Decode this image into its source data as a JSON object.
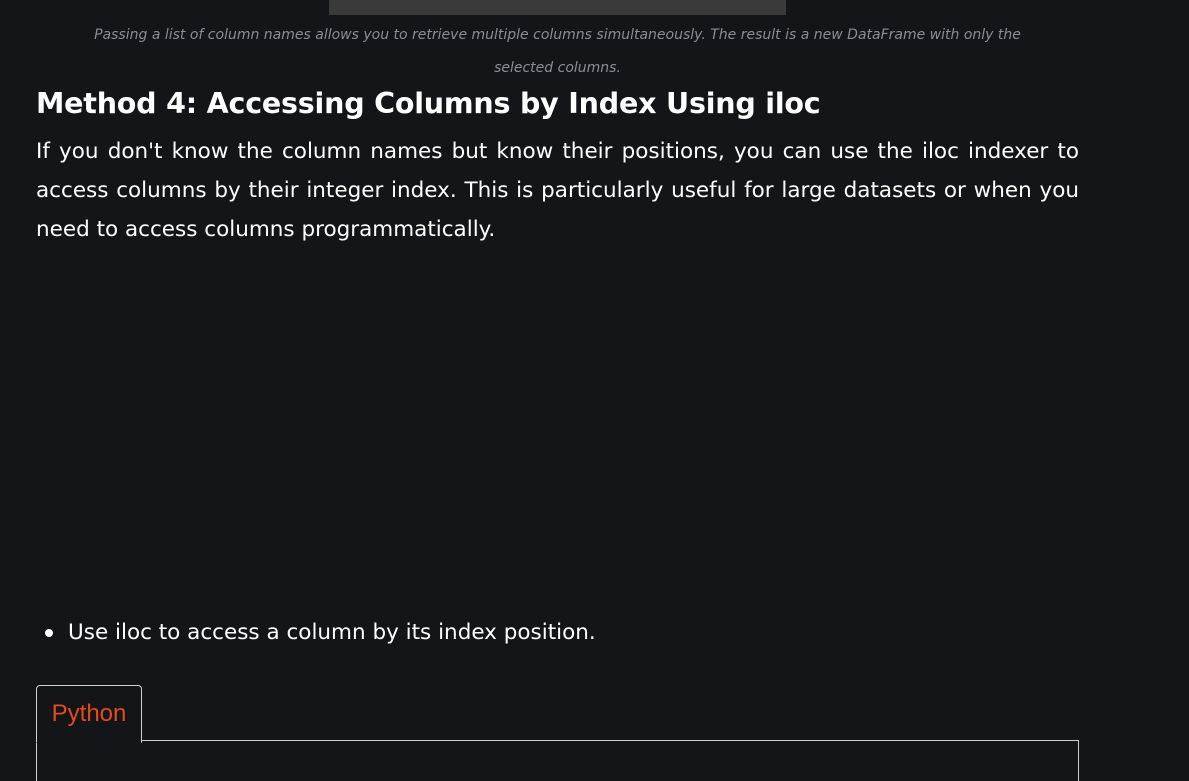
{
  "caption": {
    "line1": "Passing a list of column names allows you to retrieve multiple columns simultaneously. The result is a new DataFrame with only the",
    "line2": "selected columns."
  },
  "section": {
    "heading": "Method 4: Accessing Columns by Index Using iloc",
    "paragraph": "If you don't know the column names but know their positions, you can use the iloc indexer to access columns by their integer index. This is particularly useful for large datasets or when you need to access columns programmatically."
  },
  "bullets": [
    "Use iloc to access a column by its index position."
  ],
  "code_tabs": [
    {
      "label": "Python",
      "active": true
    }
  ],
  "colors": {
    "background": "#141519",
    "text": "#ffffff",
    "caption": "#8b8d94",
    "tab_accent": "#e24a1f",
    "tab_border": "#d0d0d0"
  }
}
